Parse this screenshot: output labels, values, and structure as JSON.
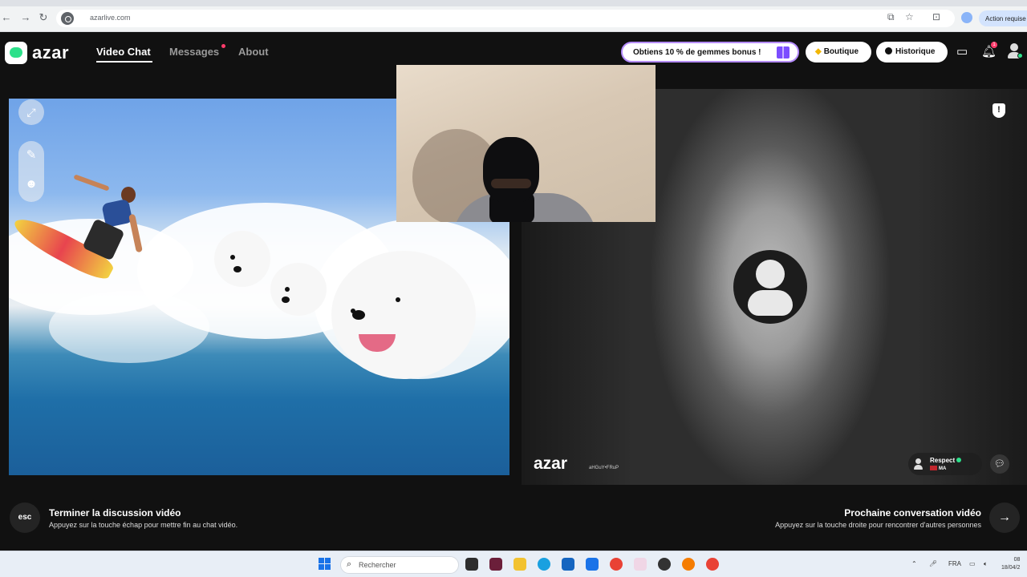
{
  "browser": {
    "url": "azarlive.com",
    "action_label": "Action requise"
  },
  "header": {
    "logo_text": "azar",
    "nav": {
      "video_chat": "Video Chat",
      "messages": "Messages",
      "about": "About"
    },
    "promo_label": "Obtiens 10 % de gemmes bonus !",
    "shop_label": "Boutique",
    "history_label": "Historique",
    "notification_count": "1"
  },
  "remote": {
    "watermark": "azar",
    "watermark_sub": "aHGuY•FRuP",
    "peer_name": "Respect",
    "peer_country": "MA"
  },
  "footer": {
    "esc_key": "esc",
    "end_title": "Terminer la discussion vidéo",
    "end_sub": "Appuyez sur la touche échap pour mettre fin au chat vidéo.",
    "next_title": "Prochaine conversation vidéo",
    "next_sub": "Appuyez sur la touche droite pour rencontrer d'autres personnes"
  },
  "taskbar": {
    "search_label": "Rechercher",
    "language": "FRA",
    "time": "08",
    "date": "18/04/2"
  },
  "colors": {
    "accent_green": "#2de08a",
    "promo_border": "#b58cff",
    "notification": "#ff3b6b"
  }
}
